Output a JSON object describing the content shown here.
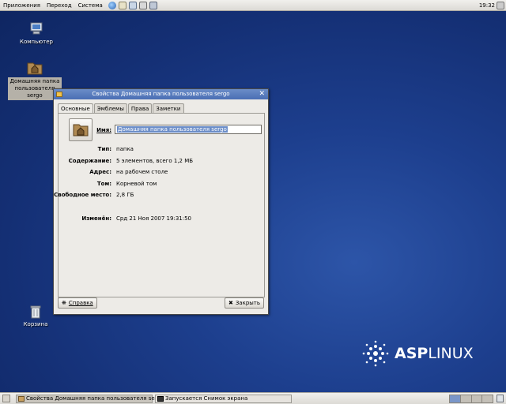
{
  "top_panel": {
    "menus": [
      "Приложения",
      "Переход",
      "Система"
    ],
    "clock": "19:32"
  },
  "desktop": {
    "computer_label": "Компьютер",
    "home_label_line1": "Домашняя папка",
    "home_label_line2": "пользователя sergo",
    "trash_label": "Корзина"
  },
  "window": {
    "title": "Свойства Домашняя папка пользователя sergo",
    "tabs": [
      "Основные",
      "Эмблемы",
      "Права",
      "Заметки"
    ],
    "name_label": "Имя:",
    "name_value": "Домашняя папка пользователя sergo",
    "props": [
      {
        "label": "Тип:",
        "value": "папка"
      },
      {
        "label": "Содержание:",
        "value": "5 элементов, всего 1,2 МБ"
      },
      {
        "label": "Адрес:",
        "value": "на рабочем столе"
      },
      {
        "label": "Том:",
        "value": "Корневой том"
      },
      {
        "label": "Свободное место:",
        "value": "2,8 ГБ"
      },
      {
        "label": "Изменён:",
        "value": "Срд 21 Ноя 2007 19:31:50"
      }
    ],
    "help_button": "Справка",
    "close_button": "Закрыть"
  },
  "bottom_panel": {
    "tasks": [
      "Свойства Домашняя папка пользователя sergo",
      "Запускается Снимок экрана"
    ]
  },
  "logo": {
    "part1": "ASP",
    "part2": "LINUX"
  },
  "colors": {
    "desktop": "#1d3f8e",
    "titlebar": "#5a7dbe",
    "selection": "#6b8dc8"
  }
}
